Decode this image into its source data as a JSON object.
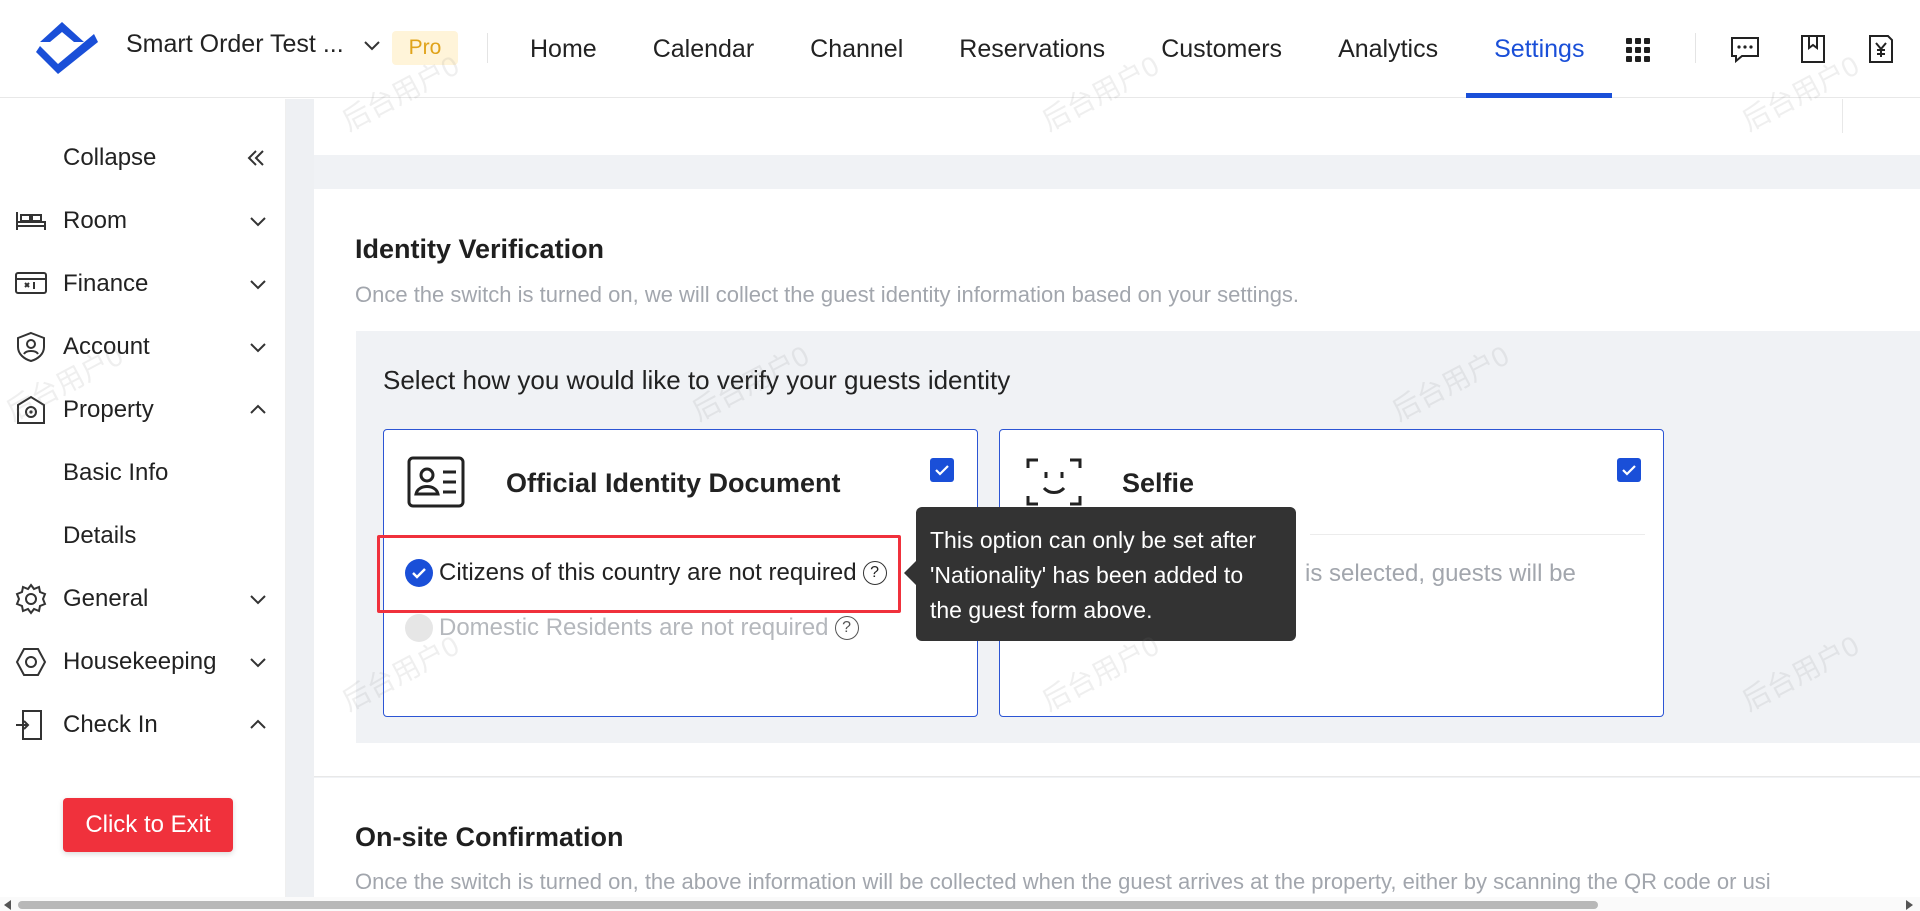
{
  "header": {
    "account_name": "Smart Order Test ...",
    "badge": "Pro",
    "nav": [
      {
        "label": "Home"
      },
      {
        "label": "Calendar"
      },
      {
        "label": "Channel"
      },
      {
        "label": "Reservations"
      },
      {
        "label": "Customers"
      },
      {
        "label": "Analytics"
      },
      {
        "label": "Settings",
        "active": true
      }
    ],
    "icons": [
      "apps-grid-icon",
      "message-icon",
      "bookmark-icon",
      "yen-receipt-icon"
    ]
  },
  "sidebar": {
    "items": [
      {
        "label": "Collapse",
        "icon": "double-chevron-left-icon"
      },
      {
        "label": "Room",
        "icon": "bed-icon",
        "expanded": false
      },
      {
        "label": "Finance",
        "icon": "money-icon",
        "expanded": false
      },
      {
        "label": "Account",
        "icon": "user-shield-icon",
        "expanded": false
      },
      {
        "label": "Property",
        "icon": "property-icon",
        "expanded": true
      },
      {
        "label": "Basic Info"
      },
      {
        "label": "Details"
      },
      {
        "label": "General",
        "icon": "gear-icon",
        "expanded": false
      },
      {
        "label": "Housekeeping",
        "icon": "hexagon-icon",
        "expanded": false
      },
      {
        "label": "Check In",
        "icon": "door-icon",
        "expanded": true
      }
    ]
  },
  "identity": {
    "title": "Identity Verification",
    "description": "Once the switch is turned on, we will collect the guest identity information based on your settings.",
    "question": "Select how you would like to verify your guests identity",
    "document_card": {
      "title": "Official Identity Document",
      "checked": true,
      "options": [
        {
          "label": "Citizens of this country are not required",
          "selected": true
        },
        {
          "label": "Domestic Residents are not required",
          "selected": false
        }
      ]
    },
    "selfie_card": {
      "title": "Selfie",
      "checked": true,
      "partial_text": "is selected, guests will be"
    },
    "tooltip": {
      "lines": [
        "This option can only be set after",
        "'Nationality' has been added to",
        "the guest form above."
      ]
    }
  },
  "onsite": {
    "title": "On-site Confirmation",
    "description": "Once the switch is turned on, the above information will be collected when the guest arrives at the property, either by scanning the QR code or usi"
  },
  "exit_button": "Click to Exit",
  "watermark": "后台用户0",
  "colors": {
    "accent": "#1a4fd8",
    "danger": "#f0313c",
    "pro_badge": "#e0a31a"
  }
}
